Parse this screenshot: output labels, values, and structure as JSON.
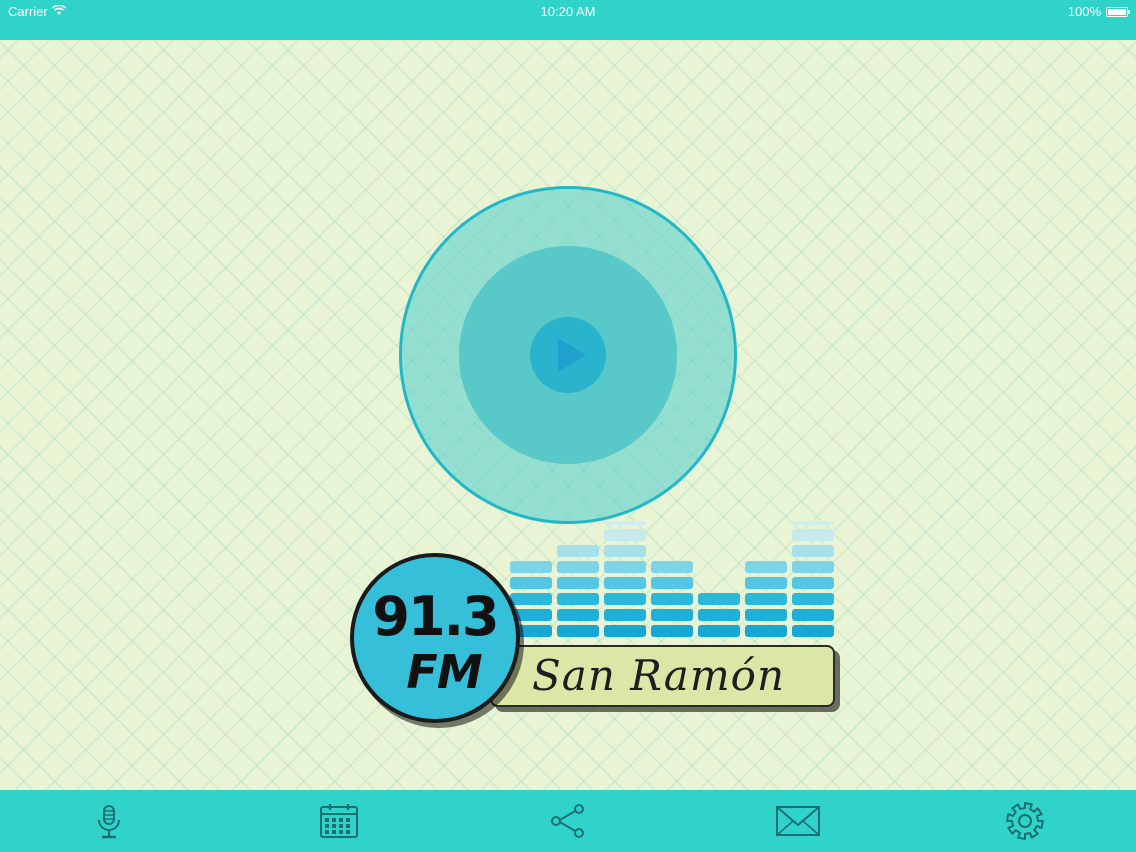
{
  "status_bar": {
    "carrier": "Carrier",
    "time": "10:20 AM",
    "battery_text": "100%",
    "battery_level": 1.0,
    "wifi_icon": "wifi-icon",
    "battery_icon": "battery-icon"
  },
  "player": {
    "play_icon": "play-icon",
    "colors": {
      "outer": "#50cdcd",
      "middle": "#59c8c8",
      "inner": "#2ab3cc",
      "triangle": "#1fa0cf"
    }
  },
  "logo": {
    "frequency": "91.3",
    "band": "FM",
    "station_name": "San Ramón",
    "equalizer_levels": [
      5,
      6,
      7,
      5,
      3,
      5,
      7
    ],
    "equalizer_peaks": [
      0,
      0,
      1,
      0,
      0,
      0,
      1
    ]
  },
  "tab_bar": {
    "items": [
      {
        "name": "live",
        "icon": "microphone-icon"
      },
      {
        "name": "schedule",
        "icon": "calendar-icon"
      },
      {
        "name": "share",
        "icon": "share-icon"
      },
      {
        "name": "contact",
        "icon": "mail-icon"
      },
      {
        "name": "settings",
        "icon": "gear-icon"
      }
    ]
  },
  "colors": {
    "bar_background": "#2fd3c9",
    "page_background": "#e8f4d4",
    "accent_blue": "#35bfd9",
    "banner_green": "#dbe7a6",
    "icon_dark": "#1e6f73"
  }
}
